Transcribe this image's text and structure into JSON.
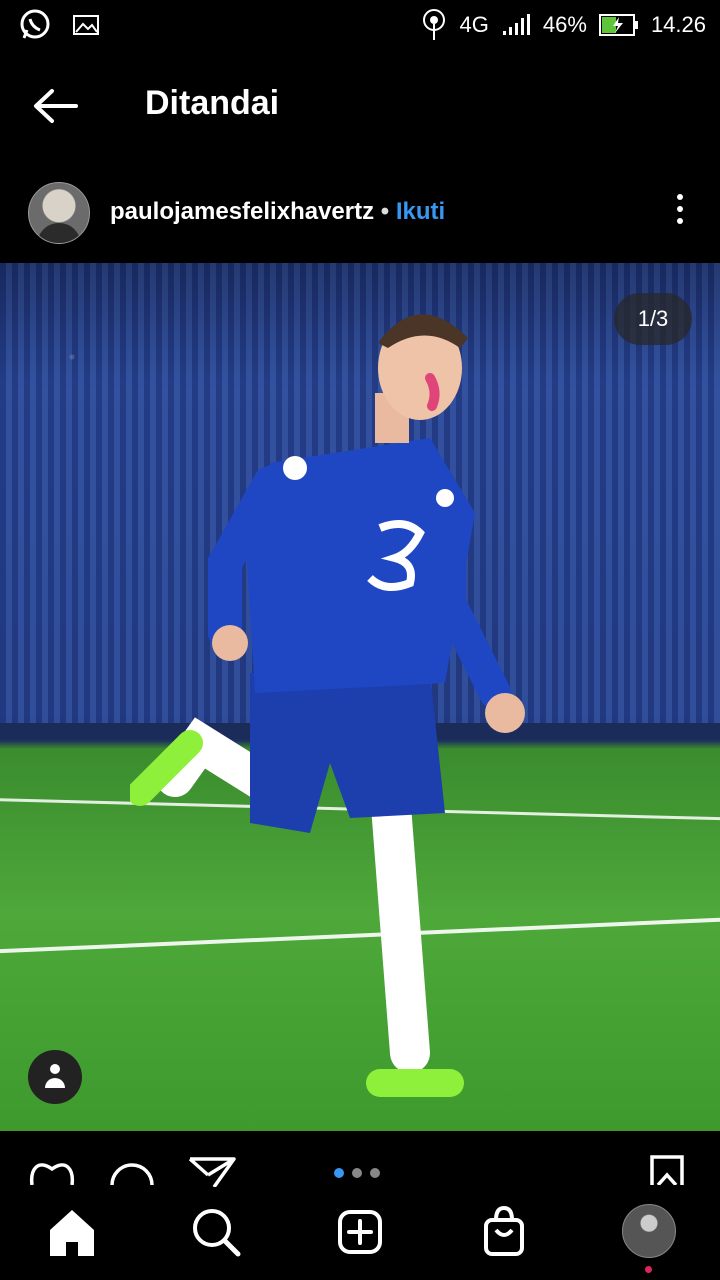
{
  "status_bar": {
    "network": "4G",
    "battery": "46%",
    "time": "14.26",
    "icons": [
      "whatsapp-icon",
      "gallery-icon",
      "hotspot-icon",
      "signal-icon",
      "battery-charging-icon"
    ]
  },
  "header": {
    "title": "Ditandai"
  },
  "post": {
    "username": "paulojamesfelixhavertz",
    "separator": "•",
    "follow_label": "Ikuti",
    "counter": "1/3",
    "carousel": {
      "total": 3,
      "active_index": 0
    }
  },
  "colors": {
    "accent": "#3897f0",
    "background": "#000000",
    "notification": "#e0245e"
  },
  "actions": [
    "like-icon",
    "comment-icon",
    "share-icon",
    "save-icon"
  ],
  "tabbar": [
    "home-icon",
    "search-icon",
    "create-icon",
    "shop-icon",
    "profile-avatar"
  ]
}
